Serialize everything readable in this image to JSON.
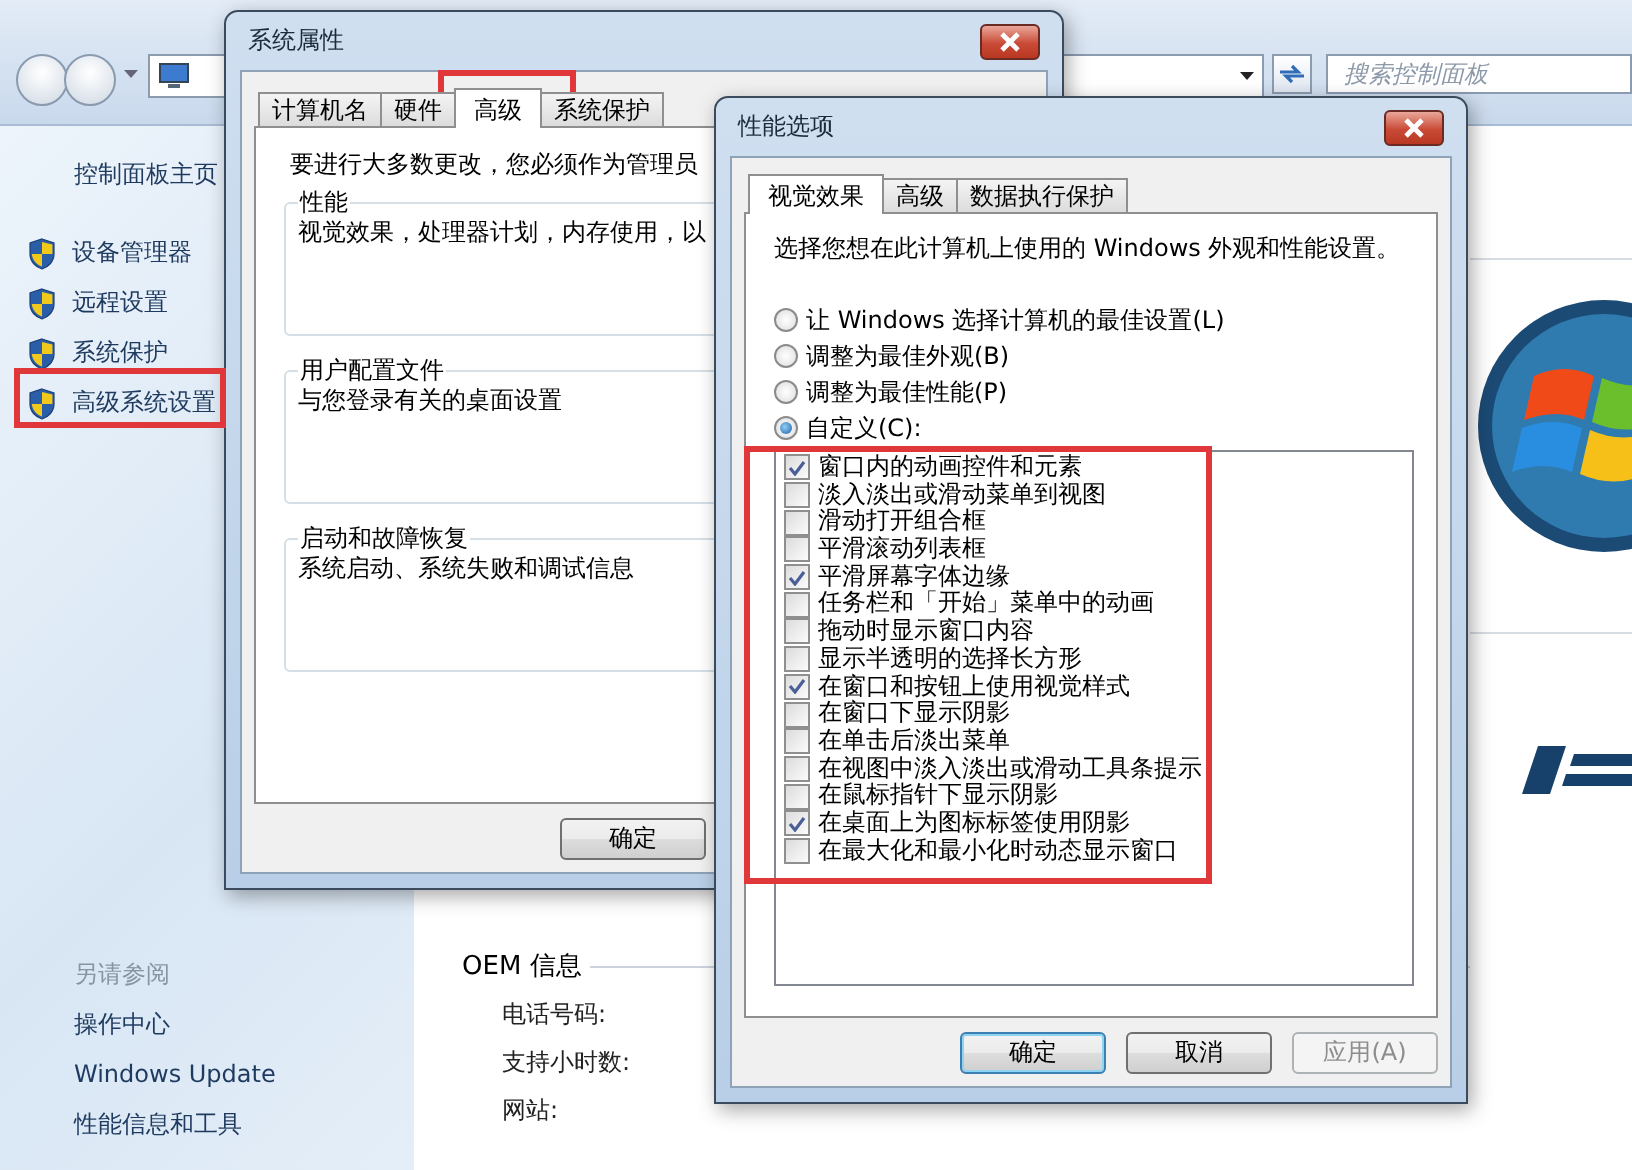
{
  "control_panel": {
    "search": {
      "placeholder": "搜索控制面板"
    },
    "home_link": "控制面板主页",
    "tasks": [
      {
        "label": "设备管理器"
      },
      {
        "label": "远程设置"
      },
      {
        "label": "系统保护"
      },
      {
        "label": "高级系统设置"
      }
    ],
    "see_also": {
      "heading": "另请参阅",
      "links": [
        "操作中心",
        "Windows Update",
        "性能信息和工具"
      ]
    },
    "oem": {
      "heading": "OEM 信息",
      "fields": [
        "电话号码:",
        "支持小时数:",
        "网站:"
      ]
    }
  },
  "system_properties": {
    "title": "系统属性",
    "tabs": [
      {
        "label": "计算机名",
        "selected": false
      },
      {
        "label": "硬件",
        "selected": false
      },
      {
        "label": "高级",
        "selected": true
      },
      {
        "label": "系统保护",
        "selected": false
      }
    ],
    "notice": "要进行大多数更改，您必须作为管理员",
    "groups": [
      {
        "title": "性能",
        "description": "视觉效果，处理器计划，内存使用，以"
      },
      {
        "title": "用户配置文件",
        "description": "与您登录有关的桌面设置"
      },
      {
        "title": "启动和故障恢复",
        "description": "系统启动、系统失败和调试信息"
      }
    ],
    "buttons": [
      {
        "label": "确定",
        "default": false,
        "disabled": false
      }
    ]
  },
  "performance_options": {
    "title": "性能选项",
    "tabs": [
      {
        "label": "视觉效果",
        "selected": true
      },
      {
        "label": "高级",
        "selected": false
      },
      {
        "label": "数据执行保护",
        "selected": false
      }
    ],
    "description": "选择您想在此计算机上使用的 Windows 外观和性能设置。",
    "options": [
      {
        "label": "让 Windows 选择计算机的最佳设置(L)",
        "selected": false
      },
      {
        "label": "调整为最佳外观(B)",
        "selected": false
      },
      {
        "label": "调整为最佳性能(P)",
        "selected": false
      },
      {
        "label": "自定义(C):",
        "selected": true
      }
    ],
    "effects": [
      {
        "label": "窗口内的动画控件和元素",
        "checked": true
      },
      {
        "label": "淡入淡出或滑动菜单到视图",
        "checked": false
      },
      {
        "label": "滑动打开组合框",
        "checked": false
      },
      {
        "label": "平滑滚动列表框",
        "checked": false
      },
      {
        "label": "平滑屏幕字体边缘",
        "checked": true
      },
      {
        "label": "任务栏和「开始」菜单中的动画",
        "checked": false
      },
      {
        "label": "拖动时显示窗口内容",
        "checked": false
      },
      {
        "label": "显示半透明的选择长方形",
        "checked": false
      },
      {
        "label": "在窗口和按钮上使用视觉样式",
        "checked": true
      },
      {
        "label": "在窗口下显示阴影",
        "checked": false
      },
      {
        "label": "在单击后淡出菜单",
        "checked": false
      },
      {
        "label": "在视图中淡入淡出或滑动工具条提示",
        "checked": false
      },
      {
        "label": "在鼠标指针下显示阴影",
        "checked": false
      },
      {
        "label": "在桌面上为图标标签使用阴影",
        "checked": true
      },
      {
        "label": "在最大化和最小化时动态显示窗口",
        "checked": false
      }
    ],
    "buttons": [
      {
        "label": "确定",
        "default": true,
        "disabled": false
      },
      {
        "label": "取消",
        "default": false,
        "disabled": false
      },
      {
        "label": "应用(A)",
        "default": false,
        "disabled": true
      }
    ]
  }
}
